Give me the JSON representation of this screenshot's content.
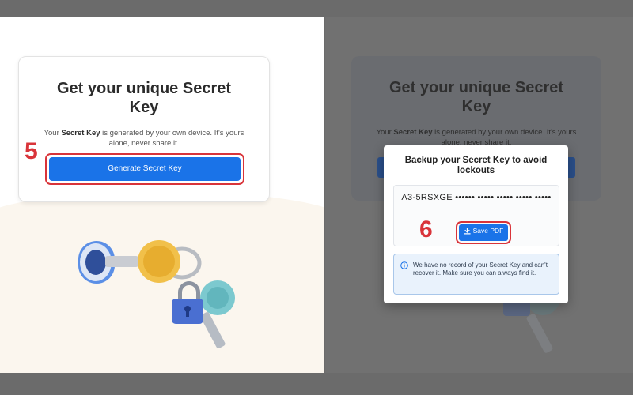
{
  "left": {
    "step_number": "5",
    "card": {
      "title": "Get your unique Secret Key",
      "desc_prefix": "Your ",
      "desc_bold": "Secret Key",
      "desc_suffix": " is generated by your own device. It's yours alone, never share it.",
      "button_label": "Generate Secret Key"
    }
  },
  "right": {
    "step_number": "6",
    "background_card": {
      "title": "Get your unique Secret Key",
      "desc_prefix": "Your ",
      "desc_bold": "Secret Key",
      "desc_suffix": " is generated by your own device. It's yours alone, never share it."
    },
    "modal": {
      "title": "Backup your Secret Key to avoid lockouts",
      "secret_key": "A3-5RSXGE •••••• ••••• ••••• ••••• •••••",
      "save_button_label": "Save PDF",
      "info_text": "We have no record of your Secret Key and can't recover it. Make sure you can always find it."
    }
  },
  "colors": {
    "accent_blue": "#1a73e8",
    "highlight_red": "#d9343a",
    "overlay_gray": "#717171",
    "info_bg": "#e9f2fc"
  },
  "icons": [
    "download-icon",
    "info-icon",
    "keys-illustration"
  ]
}
